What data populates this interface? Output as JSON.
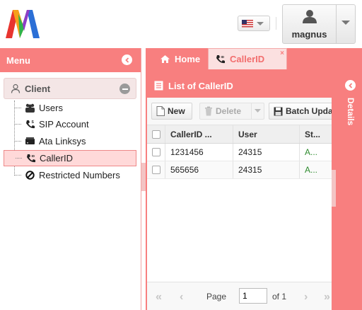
{
  "header": {
    "logo_icon": "multicolor-m-logo-icon",
    "language_flag": "us-flag-icon",
    "user": {
      "name": "magnus",
      "icon": "user-silhouette-icon"
    }
  },
  "menu": {
    "title": "Menu",
    "root": {
      "label": "Client",
      "icon": "person-outline-icon"
    },
    "items": [
      {
        "label": "Users",
        "icon": "group-icon"
      },
      {
        "label": "SIP Account",
        "icon": "phone-signal-icon"
      },
      {
        "label": "Ata Linksys",
        "icon": "ata-device-icon"
      },
      {
        "label": "CallerID",
        "icon": "callerid-phone-icon",
        "selected": true
      },
      {
        "label": "Restricted Numbers",
        "icon": "no-entry-icon"
      }
    ]
  },
  "tabs": [
    {
      "label": "Home",
      "icon": "home-icon"
    },
    {
      "label": "CallerID",
      "icon": "callerid-phone-icon",
      "close": "×",
      "active": true
    }
  ],
  "list": {
    "title": "List of CallerID",
    "toolbar": {
      "new_label": "New",
      "delete_label": "Delete",
      "batch_label": "Batch Upda"
    },
    "columns": [
      "CallerID ...",
      "User",
      "St..."
    ],
    "rows": [
      {
        "callerid": "1231456",
        "user": "24315",
        "status": "A..."
      },
      {
        "callerid": "565656",
        "user": "24315",
        "status": "A..."
      }
    ],
    "pager": {
      "page_label": "Page",
      "page_value": "1",
      "of_label": "of 1"
    }
  },
  "details": {
    "label": "Details"
  },
  "colors": {
    "accent": "#f87f7f",
    "tab_active_bg": "#fbe0e0",
    "selected_bg": "#ffd9d9",
    "status_green": "#2e8b2e"
  }
}
